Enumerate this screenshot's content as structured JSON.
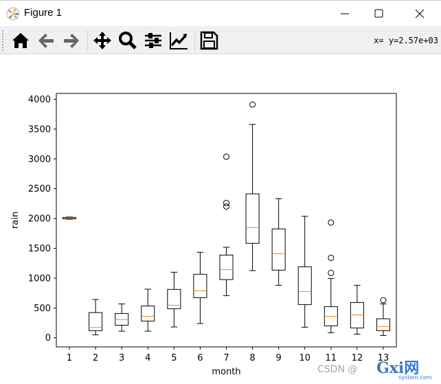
{
  "window": {
    "title": "Figure 1"
  },
  "toolbar": {
    "buttons": [
      "home-icon",
      "back-icon",
      "forward-icon",
      "pan-icon",
      "zoom-icon",
      "configure-subplots-icon",
      "edit-axis-icon",
      "save-icon"
    ],
    "coords": "x= y=2.57e+03"
  },
  "watermark": {
    "text": "CSDN @",
    "logo": "Gxi网",
    "logo_sub": "system.com"
  },
  "chart_data": {
    "type": "boxplot",
    "title": "",
    "xlabel": "month",
    "ylabel": "rain",
    "categories": [
      "1",
      "2",
      "3",
      "4",
      "5",
      "6",
      "7",
      "8",
      "9",
      "10",
      "11",
      "12",
      "13"
    ],
    "ylim": [
      -153,
      4098
    ],
    "yticks": [
      0,
      500,
      1000,
      1500,
      2000,
      2500,
      3000,
      3500,
      4000
    ],
    "grid": false,
    "box_color": "#000000",
    "median_color": "#ff7f0e",
    "boxes": [
      {
        "whislo": 1990,
        "q1": 1995,
        "med": 2010,
        "q3": 2020,
        "whishi": 2025,
        "fliers": []
      },
      {
        "whislo": 50,
        "q1": 119,
        "med": 173,
        "q3": 423,
        "whishi": 642,
        "fliers": []
      },
      {
        "whislo": 111,
        "q1": 211,
        "med": 307,
        "q3": 407,
        "whishi": 569,
        "fliers": []
      },
      {
        "whislo": 111,
        "q1": 281,
        "med": 361,
        "q3": 534,
        "whishi": 815,
        "fliers": []
      },
      {
        "whislo": 181,
        "q1": 488,
        "med": 546,
        "q3": 811,
        "whishi": 1099,
        "fliers": []
      },
      {
        "whislo": 238,
        "q1": 673,
        "med": 788,
        "q3": 1065,
        "whishi": 1434,
        "fliers": []
      },
      {
        "whislo": 707,
        "q1": 976,
        "med": 1145,
        "q3": 1387,
        "whishi": 1518,
        "fliers": [
          3036,
          2260,
          2202
        ]
      },
      {
        "whislo": 1126,
        "q1": 1584,
        "med": 1849,
        "q3": 2414,
        "whishi": 3578,
        "fliers": [
          3912
        ]
      },
      {
        "whislo": 880,
        "q1": 1134,
        "med": 1411,
        "q3": 1826,
        "whishi": 2333,
        "fliers": []
      },
      {
        "whislo": 177,
        "q1": 557,
        "med": 776,
        "q3": 1191,
        "whishi": 2037,
        "fliers": []
      },
      {
        "whislo": 85,
        "q1": 200,
        "med": 361,
        "q3": 523,
        "whishi": 995,
        "fliers": [
          1933,
          1341,
          1088
        ]
      },
      {
        "whislo": 61,
        "q1": 165,
        "med": 384,
        "q3": 592,
        "whishi": 880,
        "fliers": []
      },
      {
        "whislo": 38,
        "q1": 119,
        "med": 188,
        "q3": 319,
        "whishi": 569,
        "fliers": [
          630
        ]
      }
    ]
  }
}
